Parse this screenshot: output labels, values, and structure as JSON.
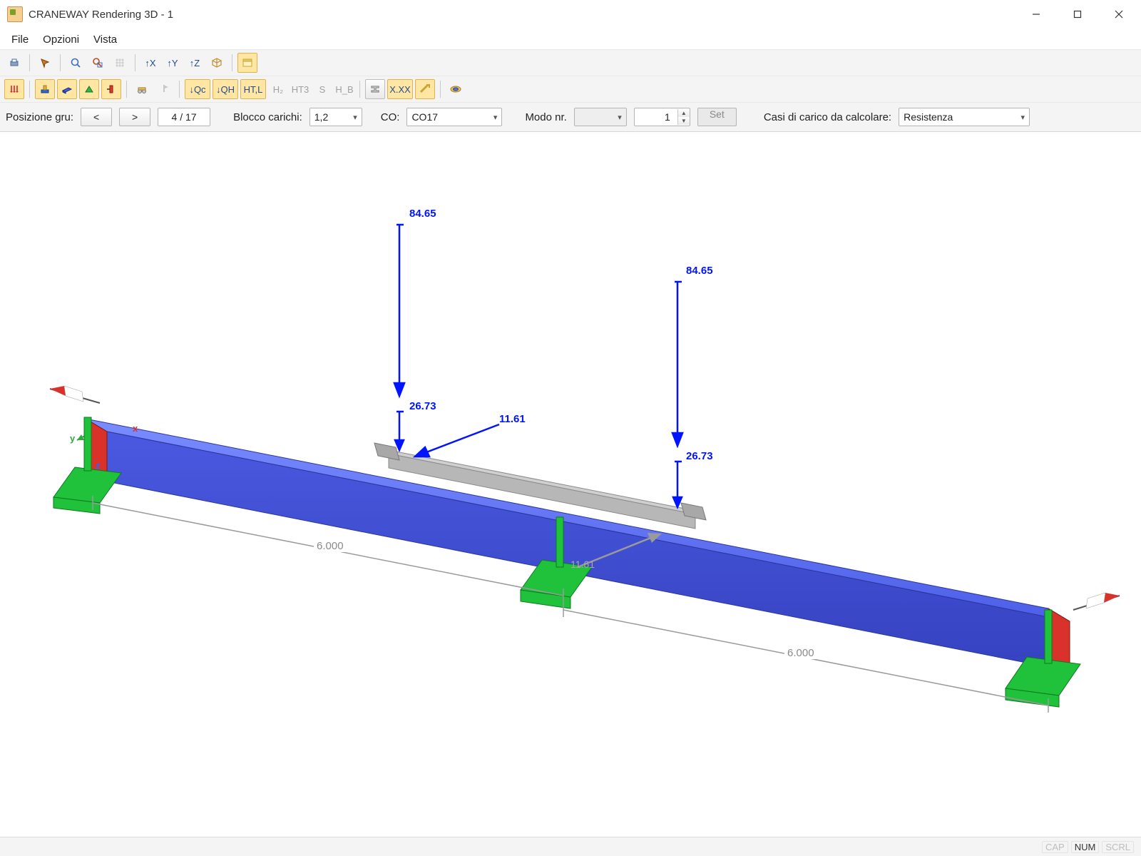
{
  "window": {
    "title": "CRANEWAY Rendering 3D - 1"
  },
  "menu": {
    "file": "File",
    "options": "Opzioni",
    "view": "Vista"
  },
  "toolbar1": {
    "fx": "↑X",
    "fy": "↑Y",
    "fz": "↑Z"
  },
  "toolbar2": {
    "qc": "↓Qc",
    "qh": "↓QH",
    "htl": "HT,L",
    "h2": "H₂",
    "ht3": "HT3",
    "s": "S",
    "hb": "H_B",
    "xxx": "X.XX"
  },
  "params": {
    "pos_label": "Posizione gru:",
    "prev": "<",
    "next": ">",
    "pos_value": "4 / 17",
    "block_label": "Blocco carichi:",
    "block_value": "1,2",
    "co_label": "CO:",
    "co_value": "CO17",
    "mode_label": "Modo nr.",
    "mode_value": "1",
    "set": "Set",
    "cases_label": "Casi di carico da calcolare:",
    "cases_value": "Resistenza"
  },
  "scene": {
    "loads": {
      "v_left": "84.65",
      "v_right": "84.65",
      "h_left": "26.73",
      "h_right": "26.73",
      "lateral": "11.61",
      "mid": "11.61"
    },
    "dims": {
      "left": "6.000",
      "right": "6.000"
    },
    "axes": {
      "x": "x",
      "y": "y",
      "z": "z"
    }
  },
  "status": {
    "cap": "CAP",
    "num": "NUM",
    "scrl": "SCRL"
  }
}
